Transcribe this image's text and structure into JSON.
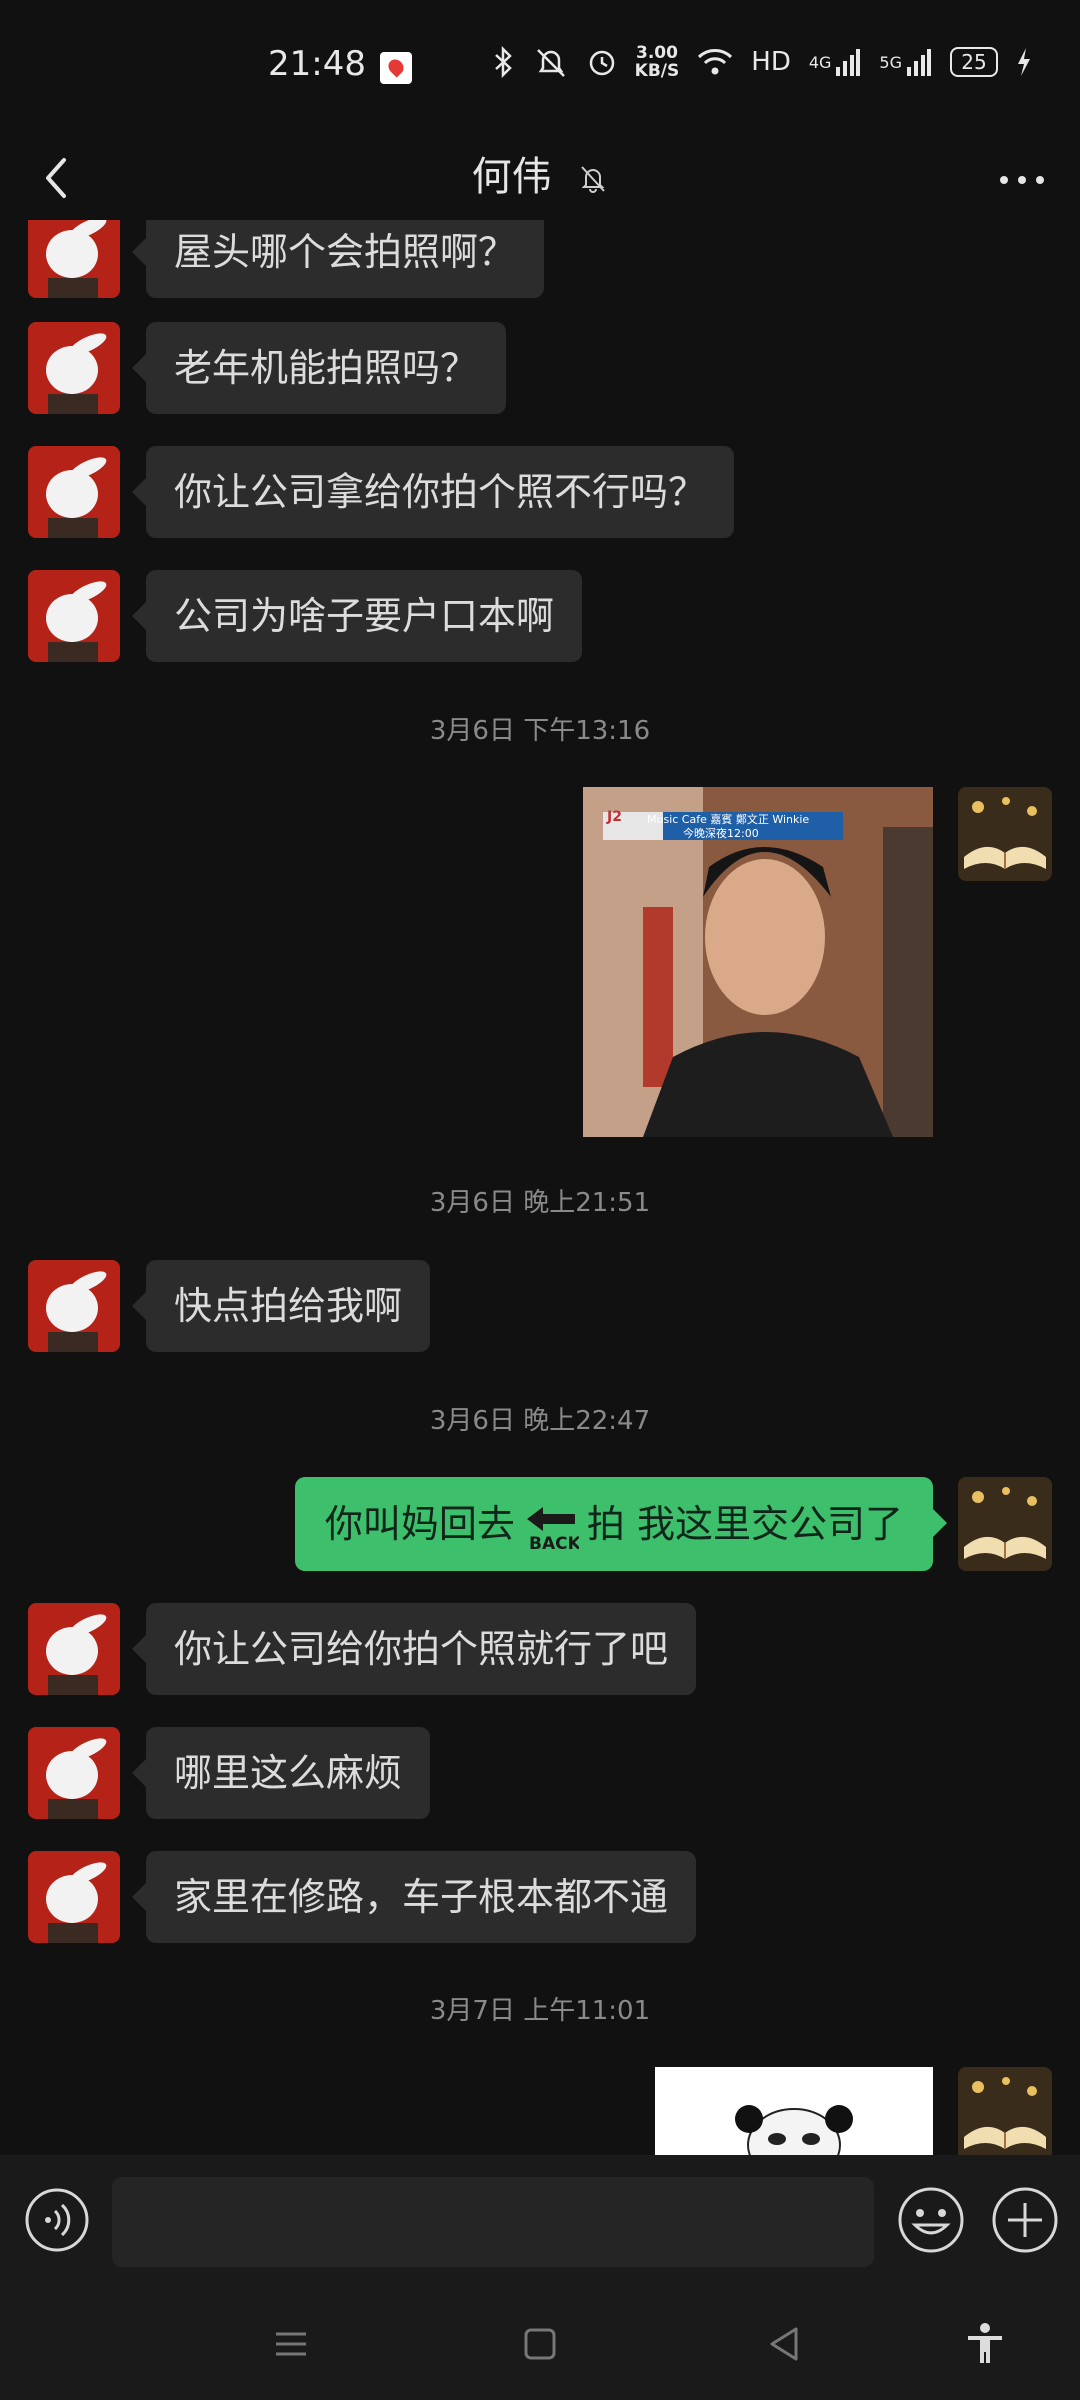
{
  "status_bar": {
    "time": "21:48",
    "speed_value": "3.00",
    "speed_unit": "KB/S",
    "hd_label": "HD",
    "net_4g": "4G",
    "net_5g": "5G",
    "battery": "25",
    "icons": [
      "bluetooth-icon",
      "mute-vibrate-icon",
      "alarm-icon",
      "wifi-icon",
      "signal-icon",
      "battery-icon",
      "charging-icon"
    ]
  },
  "header": {
    "title": "何伟",
    "icons": [
      "back-arrow-icon",
      "mute-bell-icon",
      "more-dots-icon"
    ]
  },
  "messages": [
    {
      "type": "text",
      "side": "left",
      "text": "屋头哪个会拍照啊？"
    },
    {
      "type": "text",
      "side": "left",
      "text": "老年机能拍照吗？"
    },
    {
      "type": "text",
      "side": "left",
      "text": "你让公司拿给你拍个照不行吗？"
    },
    {
      "type": "text",
      "side": "left",
      "text": "公司为啥子要户口本啊"
    },
    {
      "type": "time",
      "text": "3月6日 下午13:16"
    },
    {
      "type": "image",
      "side": "right",
      "overlay_text": "Music Cafe 嘉賓 鄭文正 Winkie",
      "overlay_sub": "今晚深夜12:00",
      "overlay_logo": "J2"
    },
    {
      "type": "time",
      "text": "3月6日 晚上21:51"
    },
    {
      "type": "text",
      "side": "left",
      "text": "快点拍给我啊"
    },
    {
      "type": "time",
      "text": "3月6日 晚上22:47"
    },
    {
      "type": "text-sticker",
      "side": "right",
      "text_before": "你叫妈回去",
      "sticker_text": "BACK",
      "text_after": "拍  我这里交公司了"
    },
    {
      "type": "text",
      "side": "left",
      "text": "你让公司给你拍个照就行了吧"
    },
    {
      "type": "text",
      "side": "left",
      "text": "哪里这么麻烦"
    },
    {
      "type": "text",
      "side": "left",
      "text": "家里在修路，车子根本都不通"
    },
    {
      "type": "time",
      "text": "3月7日 上午11:01"
    },
    {
      "type": "image",
      "side": "right",
      "description": "panda-meme"
    }
  ],
  "input_bar": {
    "placeholder": "",
    "value": "",
    "icons": [
      "voice-icon",
      "emoji-icon",
      "plus-icon"
    ]
  },
  "nav_bar": {
    "icons": [
      "menu-icon",
      "home-icon",
      "back-icon",
      "accessibility-icon"
    ]
  },
  "colors": {
    "background": "#111111",
    "bubble_left": "#2c2c2c",
    "bubble_right": "#3dbf6c",
    "timestamp": "#8a8a8a"
  }
}
